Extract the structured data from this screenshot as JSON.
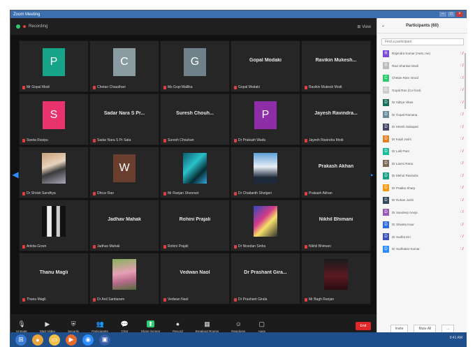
{
  "window": {
    "title": "Zoom Meeting"
  },
  "meeting_bar": {
    "left_label": "Recording",
    "right_label": "View"
  },
  "tiles": [
    {
      "kind": "avatar",
      "letter": "P",
      "color": "#17a58a",
      "label": "Mr Gopal Modi"
    },
    {
      "kind": "avatar",
      "letter": "C",
      "color": "#8a9ba2",
      "label": "Chetan Chaudhari"
    },
    {
      "kind": "avatar",
      "letter": "G",
      "color": "#6f828a",
      "label": "Ms Gopi Mallika"
    },
    {
      "kind": "name",
      "name": "Gopal Modaki",
      "label": "Gopal Modaki"
    },
    {
      "kind": "name",
      "name": "Ravikin Mukesh...",
      "label": "Ravikin Mukesh Modi"
    },
    {
      "kind": "avatar",
      "letter": "S",
      "color": "#e8336f",
      "label": "Sweta Ravipu"
    },
    {
      "kind": "name",
      "name": "Sadar Nara S Pr...",
      "label": "Sadar Nara S Pr Sata"
    },
    {
      "kind": "name",
      "name": "Suresh Chouh...",
      "label": "Suresh Chouhan"
    },
    {
      "kind": "avatar",
      "letter": "P",
      "color": "#8e2ea6",
      "label": "Dr Prakash Wadu"
    },
    {
      "kind": "name",
      "name": "Jayesh Ravindra...",
      "label": "Jayesh Ravindra Modi"
    },
    {
      "kind": "photo",
      "photo": "girl",
      "label": "Dr Shristi Sandhya"
    },
    {
      "kind": "avatar",
      "letter": "W",
      "color": "#6b3f2f",
      "label": "Dhruv Rao"
    },
    {
      "kind": "photo",
      "photo": "art",
      "label": "Mr Ranjan Sheorani"
    },
    {
      "kind": "photo",
      "photo": "man",
      "label": "Dr Chaitanth Shetgeri"
    },
    {
      "kind": "name",
      "name": "Prakash Akhan",
      "label": "Prakash Akhan"
    },
    {
      "kind": "photo",
      "photo": "bars",
      "label": "Ankita Gowri"
    },
    {
      "kind": "name",
      "name": "Jadhav Mahak",
      "label": "Jadhav Mahak"
    },
    {
      "kind": "name",
      "name": "Rohini Prajali",
      "label": "Rohini Prajali"
    },
    {
      "kind": "photo",
      "photo": "collage",
      "label": "Dr Nivedan Sinha"
    },
    {
      "kind": "name",
      "name": "Nikhil Bhimani",
      "label": "Nikhil Bhimani"
    },
    {
      "kind": "name",
      "name": "Thanu Magli",
      "label": "Thanu Magli"
    },
    {
      "kind": "photo",
      "photo": "pink",
      "label": "Dr Anil Sanbaram"
    },
    {
      "kind": "name",
      "name": "Vedwan Naol",
      "label": "Vedwan Naol"
    },
    {
      "kind": "name",
      "name": "Dr Prashant Gira...",
      "label": "Dr Prashant Girala"
    },
    {
      "kind": "photo",
      "photo": "dark",
      "label": "Mr Bagh Ranjan"
    }
  ],
  "toolbar": {
    "items": [
      {
        "label": "Unmute",
        "icon": "mic"
      },
      {
        "label": "Start Video",
        "icon": "video"
      },
      {
        "label": "Security",
        "icon": "shield"
      },
      {
        "label": "Participants",
        "icon": "people"
      },
      {
        "label": "Chat",
        "icon": "chat"
      },
      {
        "label": "Share Screen",
        "icon": "share"
      },
      {
        "label": "Record",
        "icon": "record"
      },
      {
        "label": "Breakout Rooms",
        "icon": "rooms"
      },
      {
        "label": "Reactions",
        "icon": "smile"
      },
      {
        "label": "Apps",
        "icon": "apps"
      }
    ],
    "end_label": "End"
  },
  "panel": {
    "title": "Participants (60)",
    "search_placeholder": "Find a participant",
    "invite_label": "Invite",
    "mute_all_label": "Mute All",
    "more_label": "...",
    "participants": [
      {
        "name": "Rajendra Kumar (Host, me)",
        "color": "#7a4bd8",
        "letter": "R"
      },
      {
        "name": "Ravi Shankar Modi",
        "color": "#bbbbbb",
        "letter": "R"
      },
      {
        "name": "Chetan Ram Vinod",
        "color": "#2ecc71",
        "letter": "C"
      },
      {
        "name": "Gopal Rao (Co-host)",
        "color": "#cccccc",
        "letter": "G"
      },
      {
        "name": "Dr Aditya Vikas",
        "color": "#1c6e5a",
        "letter": "D"
      },
      {
        "name": "Dr Gopal Ramana",
        "color": "#6a8b9a",
        "letter": "D"
      },
      {
        "name": "Dr Hitesh Sabapati",
        "color": "#444466",
        "letter": "D"
      },
      {
        "name": "Dr Kapil Joshi",
        "color": "#e67e22",
        "letter": "D"
      },
      {
        "name": "Dr Lalit Pant",
        "color": "#1abc9c",
        "letter": "D"
      },
      {
        "name": "Dr Laxmi Rana",
        "color": "#7a6a55",
        "letter": "D"
      },
      {
        "name": "Dr Mehul Ravindra",
        "color": "#16a085",
        "letter": "D"
      },
      {
        "name": "Dr Pratika Sharp",
        "color": "#f39c12",
        "letter": "D"
      },
      {
        "name": "Dr Rohan Joshi",
        "color": "#34495e",
        "letter": "D"
      },
      {
        "name": "Dr Sandeep Aneja",
        "color": "#9b59b6",
        "letter": "D"
      },
      {
        "name": "Dr Shweta Kaur",
        "color": "#2d6cdf",
        "letter": "D"
      },
      {
        "name": "Dr Sudha Kiri",
        "color": "#3f51b5",
        "letter": "D"
      },
      {
        "name": "Dr Sudhakar Kumar",
        "color": "#2d8cff",
        "letter": "D"
      }
    ]
  },
  "taskbar": {
    "tray_text": "9:41 AM"
  }
}
